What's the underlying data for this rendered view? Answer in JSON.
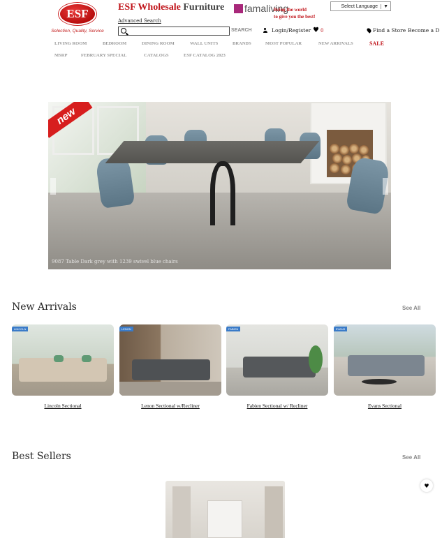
{
  "header": {
    "logo_text": "ESF",
    "logo_tagline": "Selection, Quality, Service",
    "brand_red": "ESF Wholesale",
    "brand_dark": "Furniture",
    "partner_name": "famaliving",
    "partner_slogan_1": "living the world",
    "partner_slogan_2": "to give you the best!",
    "language_select": "Select Language",
    "advanced_search": "Advanced Search",
    "search_placeholder": "",
    "search_button": "SEARCH",
    "login_register": "Login/Register",
    "wishlist_count": "0",
    "find_store": "Find a Store",
    "become": "Become a D"
  },
  "nav": {
    "row1": [
      "LIVING ROOM",
      "BEDROOM",
      "DINING ROOM",
      "WALL UNITS",
      "BRANDS",
      "MOST POPULAR",
      "NEW ARRIVALS",
      "SALE"
    ],
    "row2": [
      "MSRP",
      "FEBRUARY SPECIAL",
      "CATALOGS",
      "ESF CATALOG 2023"
    ]
  },
  "hero": {
    "badge": "new",
    "caption": "9087 Table Dark grey with 1239 swivel blue chairs"
  },
  "new_arrivals": {
    "title": "New Arrivals",
    "see_all": "See All",
    "items": [
      {
        "name": "Lincoln Sectional",
        "tag": "LINCOLN"
      },
      {
        "name": "Lenon Sectional w/Recliner",
        "tag": "LENON"
      },
      {
        "name": "Fabien Sectional w/ Recliner",
        "tag": "FABIEN"
      },
      {
        "name": "Evans Sectional",
        "tag": "EVANS"
      }
    ]
  },
  "best_sellers": {
    "title": "Best Sellers",
    "see_all": "See All"
  },
  "colors": {
    "brand_red": "#c0141a",
    "nav_gray": "#999999",
    "partner_magenta": "#a8287a"
  },
  "icons": [
    "search-icon",
    "user-icon",
    "heart-icon",
    "map-pin-icon",
    "chevron-left-icon",
    "chevron-right-icon"
  ]
}
